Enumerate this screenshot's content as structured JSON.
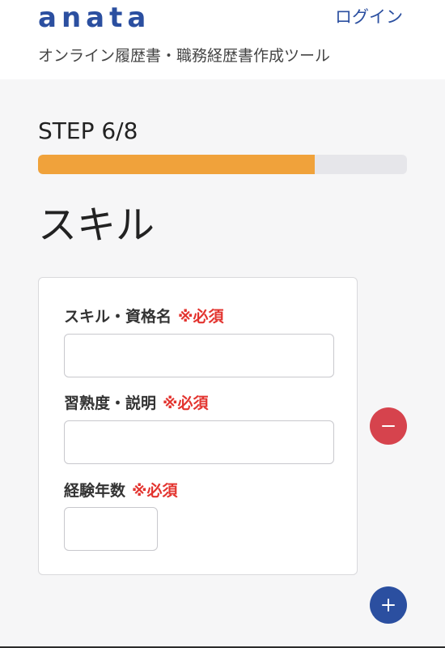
{
  "header": {
    "logo_text": "anata",
    "login_label": "ログイン",
    "tagline": "オンライン履歴書・職務経歴書作成ツール"
  },
  "progress": {
    "step_label": "STEP 6/8",
    "current_step": 6,
    "total_steps": 8,
    "fill_fraction": 0.75
  },
  "section": {
    "title": "スキル"
  },
  "form": {
    "required_mark": "※必須",
    "fields": [
      {
        "label": "スキル・資格名",
        "value": ""
      },
      {
        "label": "習熟度・説明",
        "value": ""
      },
      {
        "label": "経験年数",
        "value": ""
      }
    ]
  },
  "actions": {
    "remove_icon": "minus-icon",
    "add_icon": "plus-icon"
  },
  "colors": {
    "brand": "#2b4fa0",
    "accent": "#f0a23b",
    "required": "#e3342f",
    "remove": "#d6434d"
  }
}
